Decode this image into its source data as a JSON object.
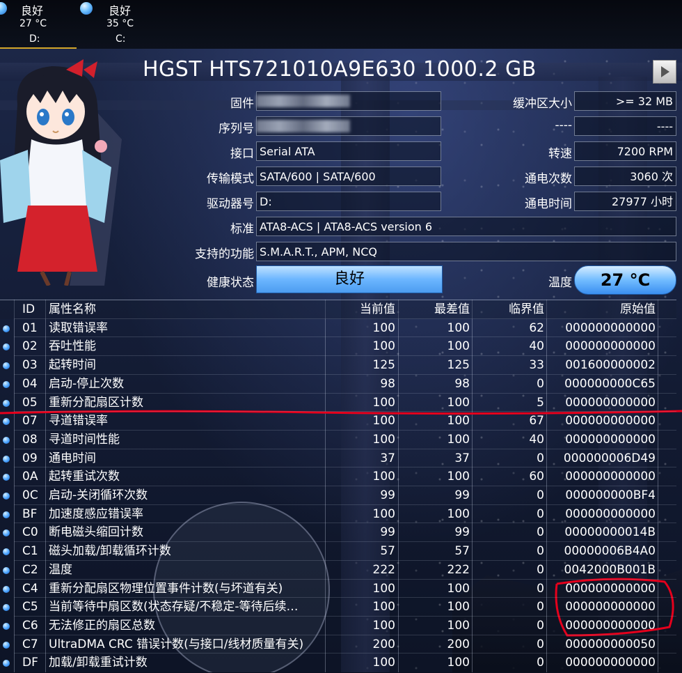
{
  "drives": [
    {
      "status": "良好",
      "temp": "27 °C",
      "letter": "D:"
    },
    {
      "status": "良好",
      "temp": "35 °C",
      "letter": "C:"
    }
  ],
  "disk": {
    "title": "HGST HTS721010A9E630 1000.2 GB",
    "labels": {
      "firmware": "固件",
      "serial": "序列号",
      "interface": "接口",
      "transfer_mode": "传输模式",
      "drive_letter": "驱动器号",
      "standard": "标准",
      "features": "支持的功能",
      "health": "健康状态",
      "buffer": "缓冲区大小",
      "blank": "----",
      "rotation": "转速",
      "power_on_count": "通电次数",
      "power_on_hours": "通电时间",
      "temperature": "温度"
    },
    "values": {
      "interface": "Serial ATA",
      "transfer_mode": "SATA/600 | SATA/600",
      "drive_letter": "D:",
      "standard": "ATA8-ACS | ATA8-ACS version 6",
      "features": "S.M.A.R.T., APM, NCQ",
      "health": "良好",
      "buffer": ">= 32 MB",
      "blank": "----",
      "rotation": "7200 RPM",
      "power_on_count": "3060 次",
      "power_on_hours": "27977 小时",
      "temperature": "27 °C"
    }
  },
  "smart": {
    "headers": {
      "id": "ID",
      "name": "属性名称",
      "current": "当前值",
      "worst": "最差值",
      "threshold": "临界值",
      "raw": "原始值"
    },
    "rows": [
      {
        "id": "01",
        "name": "读取错误率",
        "current": "100",
        "worst": "100",
        "threshold": "62",
        "raw": "000000000000"
      },
      {
        "id": "02",
        "name": "吞吐性能",
        "current": "100",
        "worst": "100",
        "threshold": "40",
        "raw": "000000000000"
      },
      {
        "id": "03",
        "name": "起转时间",
        "current": "125",
        "worst": "125",
        "threshold": "33",
        "raw": "001600000002"
      },
      {
        "id": "04",
        "name": "启动-停止次数",
        "current": "98",
        "worst": "98",
        "threshold": "0",
        "raw": "000000000C65"
      },
      {
        "id": "05",
        "name": "重新分配扇区计数",
        "current": "100",
        "worst": "100",
        "threshold": "5",
        "raw": "000000000000"
      },
      {
        "id": "07",
        "name": "寻道错误率",
        "current": "100",
        "worst": "100",
        "threshold": "67",
        "raw": "000000000000"
      },
      {
        "id": "08",
        "name": "寻道时间性能",
        "current": "100",
        "worst": "100",
        "threshold": "40",
        "raw": "000000000000"
      },
      {
        "id": "09",
        "name": "通电时间",
        "current": "37",
        "worst": "37",
        "threshold": "0",
        "raw": "000000006D49"
      },
      {
        "id": "0A",
        "name": "起转重试次数",
        "current": "100",
        "worst": "100",
        "threshold": "60",
        "raw": "000000000000"
      },
      {
        "id": "0C",
        "name": "启动-关闭循环次数",
        "current": "99",
        "worst": "99",
        "threshold": "0",
        "raw": "000000000BF4"
      },
      {
        "id": "BF",
        "name": "加速度感应错误率",
        "current": "100",
        "worst": "100",
        "threshold": "0",
        "raw": "000000000000"
      },
      {
        "id": "C0",
        "name": "断电磁头缩回计数",
        "current": "99",
        "worst": "99",
        "threshold": "0",
        "raw": "00000000014B"
      },
      {
        "id": "C1",
        "name": "磁头加载/卸载循环计数",
        "current": "57",
        "worst": "57",
        "threshold": "0",
        "raw": "00000006B4A0"
      },
      {
        "id": "C2",
        "name": "温度",
        "current": "222",
        "worst": "222",
        "threshold": "0",
        "raw": "0042000B001B"
      },
      {
        "id": "C4",
        "name": "重新分配扇区物理位置事件计数(与坏道有关)",
        "current": "100",
        "worst": "100",
        "threshold": "0",
        "raw": "000000000000"
      },
      {
        "id": "C5",
        "name": "当前等待中扇区数(状态存疑/不稳定-等待后续…",
        "current": "100",
        "worst": "100",
        "threshold": "0",
        "raw": "000000000000"
      },
      {
        "id": "C6",
        "name": "无法修正的扇区总数",
        "current": "100",
        "worst": "100",
        "threshold": "0",
        "raw": "000000000000"
      },
      {
        "id": "C7",
        "name": "UltraDMA CRC 错误计数(与接口/线材质量有关)",
        "current": "200",
        "worst": "200",
        "threshold": "0",
        "raw": "000000000050"
      },
      {
        "id": "DF",
        "name": "加载/卸载重试计数",
        "current": "100",
        "worst": "100",
        "threshold": "0",
        "raw": "000000000000"
      }
    ]
  },
  "colors": {
    "status_blue": "#4aa3ff",
    "annotation_red": "#e5001c",
    "tab_accent": "#d4a628"
  },
  "icons": {
    "status_orb": "circle",
    "next_disk": "play-triangle"
  }
}
